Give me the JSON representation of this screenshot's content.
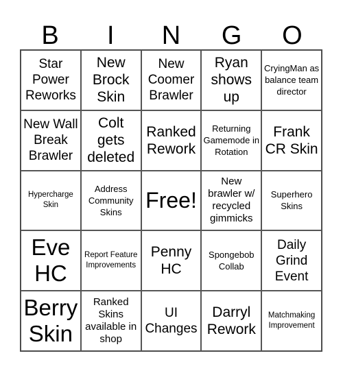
{
  "header": [
    "B",
    "I",
    "N",
    "G",
    "O"
  ],
  "cells": [
    "Star Power Reworks",
    "New Brock Skin",
    "New Coomer Brawler",
    "Ryan shows up",
    "CryingMan as balance team director",
    "New Wall Break Brawler",
    "Colt gets deleted",
    "Ranked Rework",
    "Returning Gamemode in Rotation",
    "Frank CR Skin",
    "Hypercharge Skin",
    "Address Community Skins",
    "Free!",
    "New brawler w/ recycled gimmicks",
    "Superhero Skins",
    "Eve HC",
    "Report Feature Improvements",
    "Penny HC",
    "Spongebob Collab",
    "Daily Grind Event",
    "Berry Skin",
    "Ranked Skins available in shop",
    "UI Changes",
    "Darryl Rework",
    "Matchmaking Improvement"
  ]
}
